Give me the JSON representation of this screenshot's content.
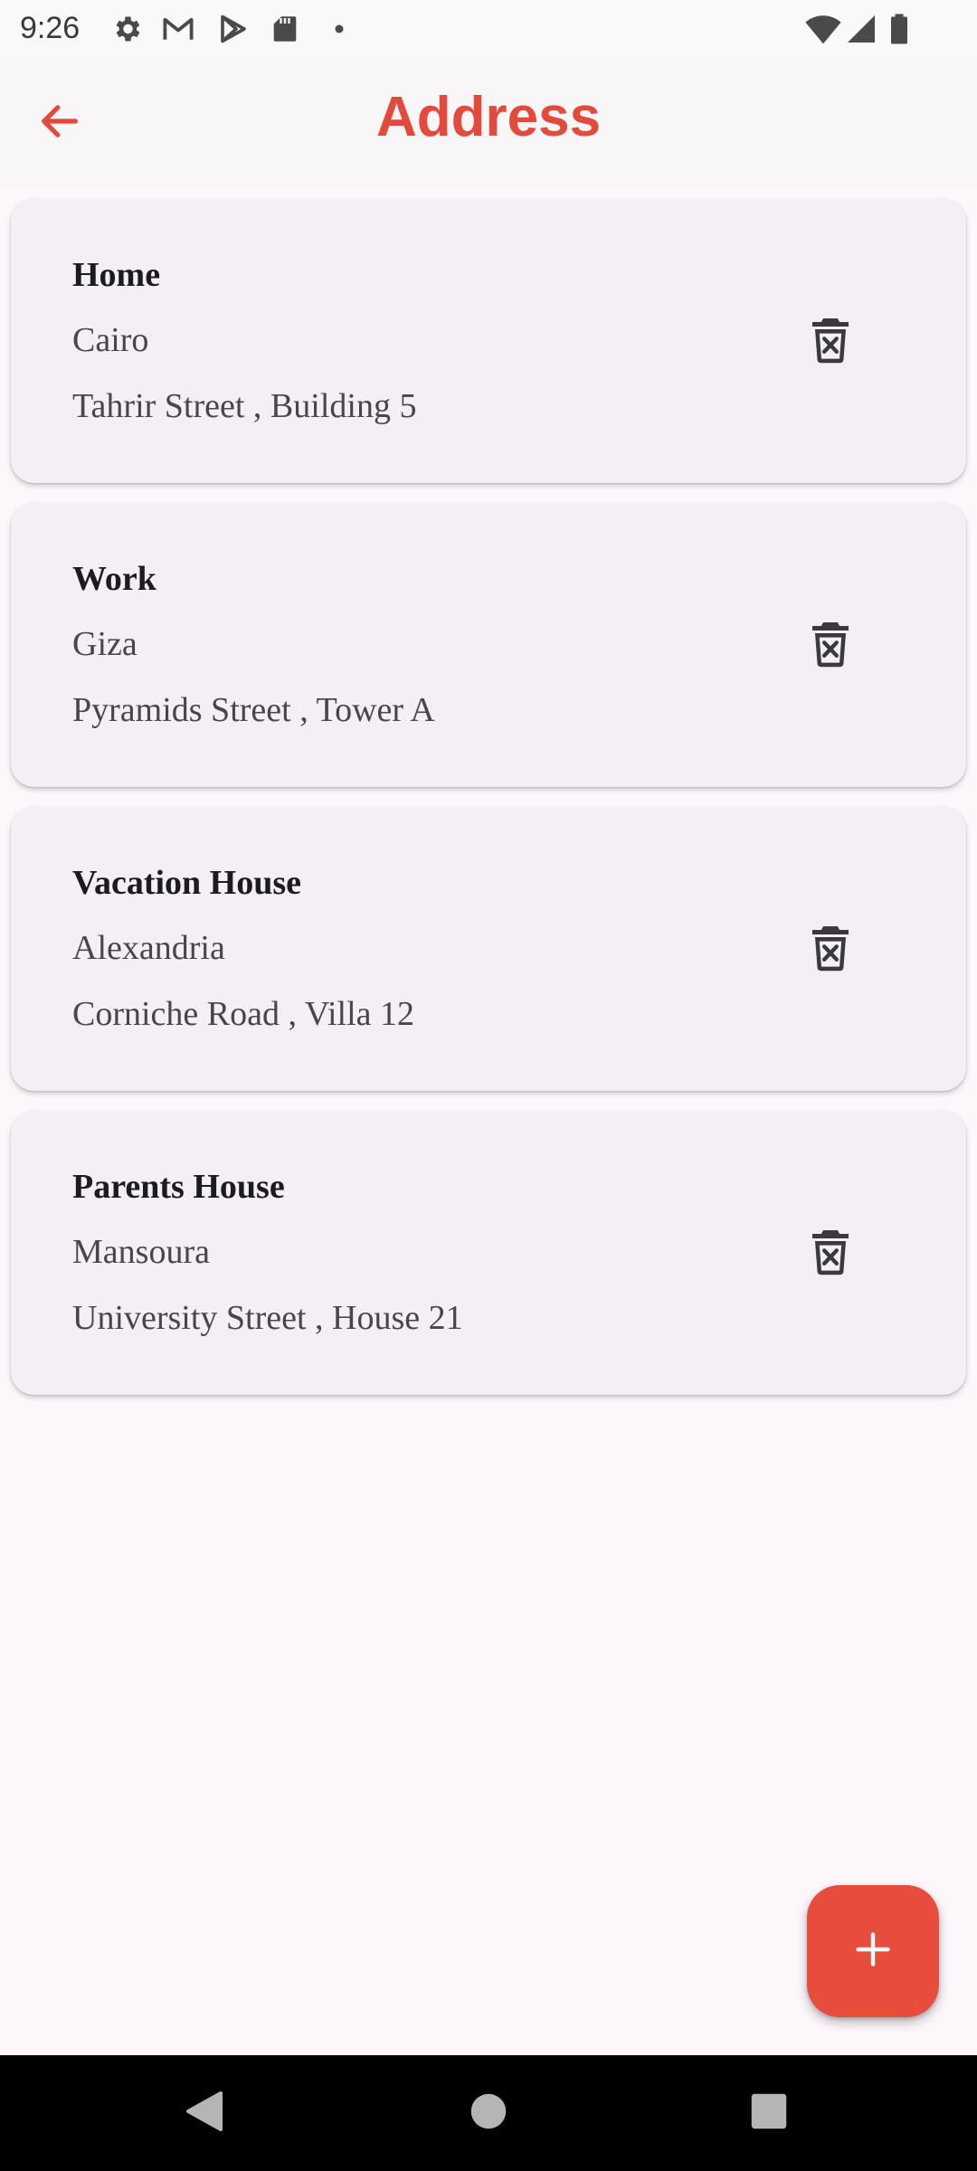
{
  "status_bar": {
    "time": "9:26",
    "left_icons": [
      "gear-icon",
      "gmail-icon",
      "play-store-icon",
      "sd-card-icon",
      "dot-icon"
    ],
    "right_icons": [
      "wifi-icon",
      "signal-icon",
      "battery-icon"
    ]
  },
  "app_bar": {
    "title": "Address",
    "back_icon": "arrow-left-icon"
  },
  "addresses": [
    {
      "title": "Home",
      "city": "Cairo",
      "street": "Tahrir Street , Building 5"
    },
    {
      "title": "Work",
      "city": "Giza",
      "street": "Pyramids Street , Tower A"
    },
    {
      "title": "Vacation House",
      "city": "Alexandria",
      "street": "Corniche Road , Villa 12"
    },
    {
      "title": "Parents House",
      "city": "Mansoura",
      "street": "University Street , House 21"
    }
  ],
  "fab": {
    "icon": "plus-icon"
  },
  "colors": {
    "accent": "#e24a3b",
    "fab": "#e84c3d",
    "card_bg": "#f4eff4",
    "page_bg": "#fdf7fc"
  },
  "nav_bar": {
    "buttons": [
      "back-triangle-icon",
      "home-circle-icon",
      "recents-square-icon"
    ]
  }
}
